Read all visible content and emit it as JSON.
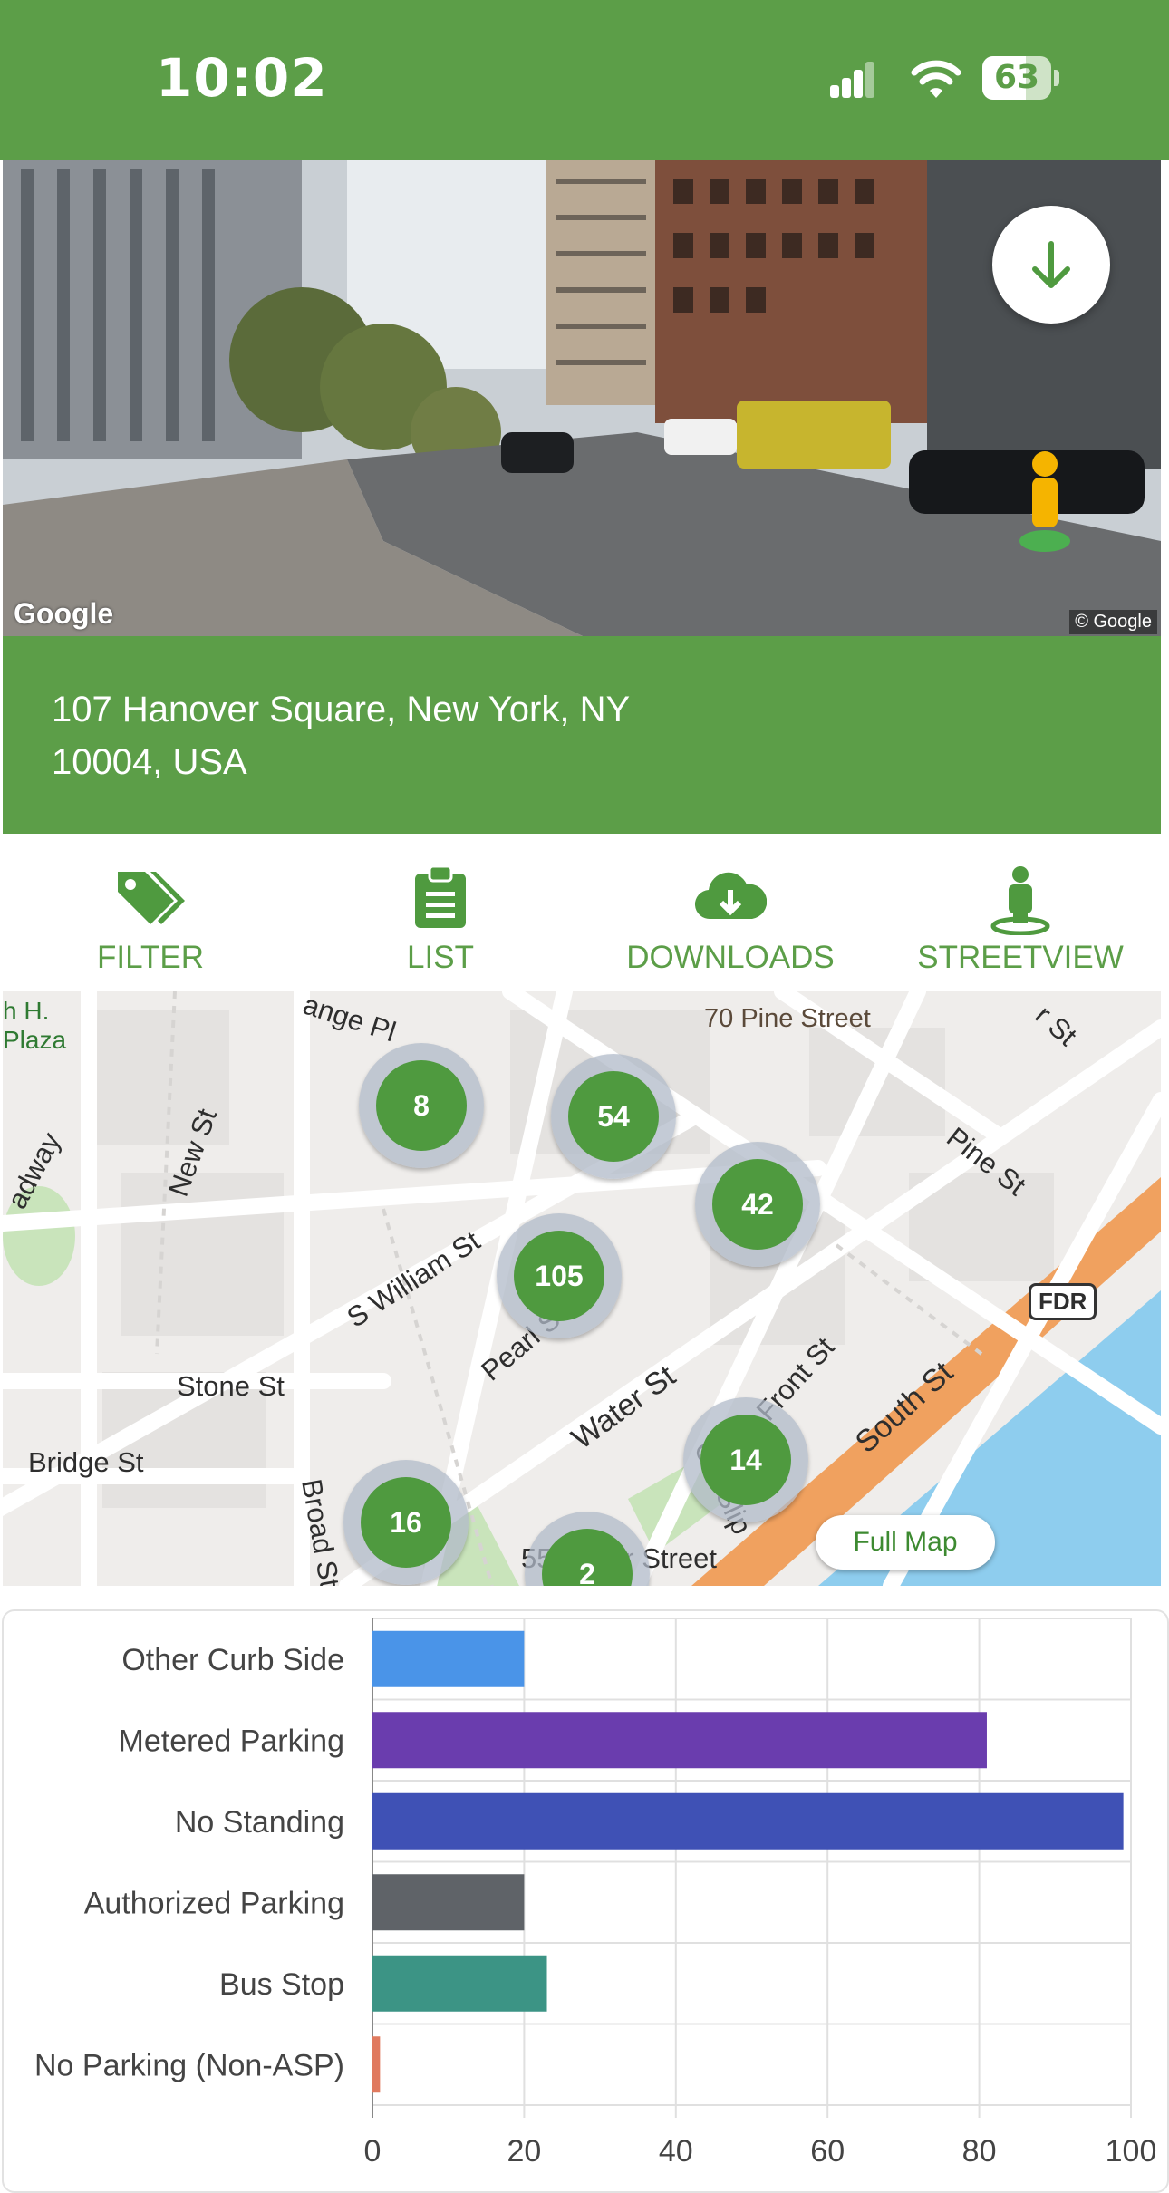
{
  "status_bar": {
    "time": "10:02",
    "battery_percent": "63",
    "battery_level": 0.63,
    "icons": [
      "cellular-signal-icon",
      "wifi-icon",
      "battery-icon"
    ]
  },
  "street_view": {
    "logo": "Google",
    "copyright": "© Google",
    "download_icon": "arrow-down-icon",
    "pegman_icon": "pegman-icon"
  },
  "address": {
    "line1": "107 Hanover Square, New York, NY",
    "line2": "10004, USA"
  },
  "actions": [
    {
      "label": "FILTER",
      "icon": "tags-icon"
    },
    {
      "label": "LIST",
      "icon": "clipboard-list-icon"
    },
    {
      "label": "DOWNLOADS",
      "icon": "cloud-download-icon"
    },
    {
      "label": "STREETVIEW",
      "icon": "street-view-icon"
    }
  ],
  "map": {
    "labels": {
      "plaza": "h H.\nPlaza",
      "exchange_pl": "ange Pl",
      "pine_street_70": "70 Pine Street",
      "pine_st": "Pine St",
      "new_st": "New St",
      "broadway": "adway",
      "s_william_st": "S William St",
      "pearl_st": "Pearl St",
      "water_st": "Water St",
      "front_st": "Front St",
      "south_st": "South St",
      "stone_st": "Stone St",
      "bridge_st": "Bridge St",
      "broad_st": "Broad St",
      "old_slip": "Old Slip",
      "water_street_55": "55 Water Street",
      "fdr": "FDR",
      "corner_st": "r St"
    },
    "clusters": [
      "8",
      "54",
      "42",
      "105",
      "14",
      "16",
      "2"
    ],
    "full_map_button": "Full Map"
  },
  "chart_data": {
    "type": "bar",
    "orientation": "horizontal",
    "categories": [
      "Other Curb Side",
      "Metered Parking",
      "No Standing",
      "Authorized Parking",
      "Bus Stop",
      "No Parking (Non-ASP)"
    ],
    "values": [
      20,
      81,
      99,
      20,
      23,
      1
    ],
    "colors": [
      "#4a94e8",
      "#6a3dae",
      "#3f51b5",
      "#5f6368",
      "#3c9485",
      "#e07a5f"
    ],
    "xlim": [
      0,
      100
    ],
    "xticks": [
      "0",
      "20",
      "40",
      "60",
      "80",
      "100"
    ],
    "grid": true
  }
}
